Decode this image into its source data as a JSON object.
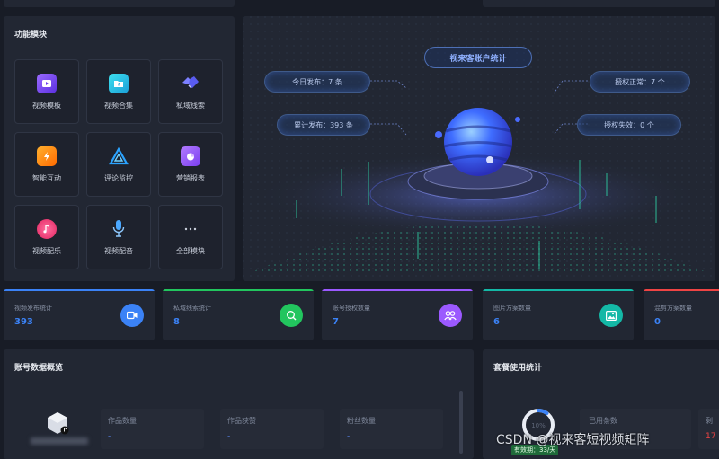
{
  "modules": {
    "title": "功能模块",
    "items": [
      {
        "label": "视频模板",
        "icon": "video-template-icon",
        "color": "#7b4dff"
      },
      {
        "label": "视频合集",
        "icon": "video-collection-icon",
        "color": "#22c3d6"
      },
      {
        "label": "私域线索",
        "icon": "handshake-icon",
        "color": "#6a6cff"
      },
      {
        "label": "智能互动",
        "icon": "lightning-icon",
        "color": "#ff8a1f"
      },
      {
        "label": "评论监控",
        "icon": "monitor-triangle-icon",
        "color": "#2aa3ff"
      },
      {
        "label": "营销报表",
        "icon": "pie-report-icon",
        "color": "#9b59ff"
      },
      {
        "label": "视频配乐",
        "icon": "music-icon",
        "color": "#ff3d7f"
      },
      {
        "label": "视频配音",
        "icon": "microphone-icon",
        "color": "#4aa8ff"
      },
      {
        "label": "全部模块",
        "icon": "more-icon",
        "color": "#8790a3"
      }
    ]
  },
  "hero": {
    "title": "视来客账户统计",
    "today_published": "今日发布：7 条",
    "total_published": "累计发布：393 条",
    "auth_normal": "授权正常：7 个",
    "auth_failed": "授权失效：0 个"
  },
  "stats": [
    {
      "label": "视频发布统计",
      "value": "393",
      "color": "#3b82f6",
      "icon": "video-camera-icon"
    },
    {
      "label": "私域线索统计",
      "value": "8",
      "color": "#22c55e",
      "icon": "search-chat-icon"
    },
    {
      "label": "账号授权数量",
      "value": "7",
      "color": "#9b59ff",
      "icon": "users-icon"
    },
    {
      "label": "图片方案数量",
      "value": "6",
      "color": "#14b8a6",
      "icon": "image-icon"
    },
    {
      "label": "混剪方案数量",
      "value": "0",
      "color": "#ef4444",
      "icon": "scissors-icon"
    }
  ],
  "account": {
    "title": "账号数据概览",
    "boxes": [
      {
        "label": "作品数量",
        "value": "-"
      },
      {
        "label": "作品获赞",
        "value": "-"
      },
      {
        "label": "粉丝数量",
        "value": "-"
      }
    ]
  },
  "package": {
    "title": "套餐使用统计",
    "used_label": "已用条数",
    "valid_period": "有效期：33/天",
    "percent": "10%",
    "percent_value": 10,
    "side_label": "剩",
    "side_value": "17"
  },
  "watermark": "CSDN @视来客短视频矩阵"
}
